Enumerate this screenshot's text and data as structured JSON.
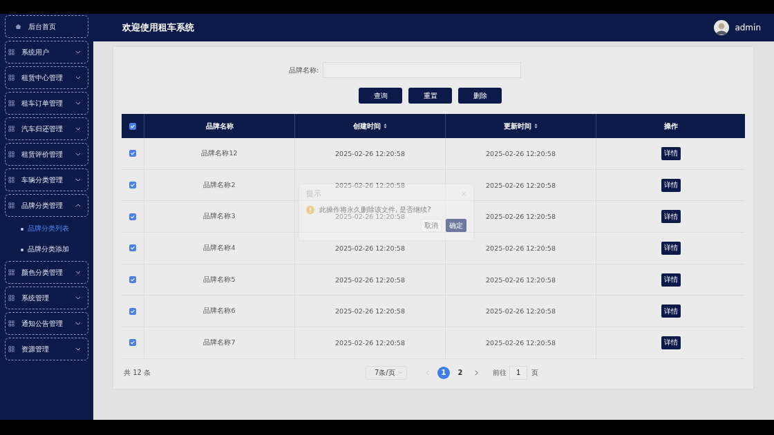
{
  "sidebar": {
    "items": [
      {
        "kind": "home",
        "label": "后台首页"
      },
      {
        "kind": "group",
        "label": "系统用户",
        "expanded": false
      },
      {
        "kind": "group",
        "label": "租赁中心管理",
        "expanded": false
      },
      {
        "kind": "group",
        "label": "租车订单管理",
        "expanded": false
      },
      {
        "kind": "group",
        "label": "汽车归还管理",
        "expanded": false
      },
      {
        "kind": "group",
        "label": "租赁评价管理",
        "expanded": false
      },
      {
        "kind": "group",
        "label": "车辆分类管理",
        "expanded": false
      },
      {
        "kind": "group",
        "label": "品牌分类管理",
        "expanded": true,
        "children": [
          {
            "label": "品牌分类列表",
            "selected": true
          },
          {
            "label": "品牌分类添加",
            "selected": false
          }
        ]
      },
      {
        "kind": "group",
        "label": "颜色分类管理",
        "expanded": false
      },
      {
        "kind": "group",
        "label": "系统管理",
        "expanded": false
      },
      {
        "kind": "group",
        "label": "通知公告管理",
        "expanded": false
      },
      {
        "kind": "group",
        "label": "资源管理",
        "expanded": false
      }
    ]
  },
  "header": {
    "title": "欢迎使用租车系统",
    "user": "admin"
  },
  "search": {
    "label": "品牌名称:",
    "buttons": [
      "查询",
      "重置",
      "删除"
    ]
  },
  "table": {
    "all_checked": true,
    "columns": [
      {
        "label": "品牌名称",
        "sortable": false
      },
      {
        "label": "创建时间",
        "sortable": true
      },
      {
        "label": "更新时间",
        "sortable": true
      },
      {
        "label": "操作",
        "sortable": false
      }
    ],
    "rows": [
      {
        "checked": true,
        "name": "品牌名称12",
        "created": "2025-02-26 12:20:58",
        "updated": "2025-02-26 12:20:58",
        "action": "详情"
      },
      {
        "checked": true,
        "name": "品牌名称2",
        "created": "2025-02-26 12:20:58",
        "updated": "2025-02-26 12:20:58",
        "action": "详情"
      },
      {
        "checked": true,
        "name": "品牌名称3",
        "created": "2025-02-26 12:20:58",
        "updated": "2025-02-26 12:20:58",
        "action": "详情"
      },
      {
        "checked": true,
        "name": "品牌名称4",
        "created": "2025-02-26 12:20:58",
        "updated": "2025-02-26 12:20:58",
        "action": "详情"
      },
      {
        "checked": true,
        "name": "品牌名称5",
        "created": "2025-02-26 12:20:58",
        "updated": "2025-02-26 12:20:58",
        "action": "详情"
      },
      {
        "checked": true,
        "name": "品牌名称6",
        "created": "2025-02-26 12:20:58",
        "updated": "2025-02-26 12:20:58",
        "action": "详情"
      },
      {
        "checked": true,
        "name": "品牌名称7",
        "created": "2025-02-26 12:20:58",
        "updated": "2025-02-26 12:20:58",
        "action": "详情"
      }
    ]
  },
  "pagination": {
    "total": "共 12 条",
    "page_size": "7条/页",
    "pages": [
      {
        "label": "1",
        "selected": true
      },
      {
        "label": "2",
        "selected": false
      }
    ],
    "goto_label": "前往",
    "goto_value": "1",
    "goto_suffix": "页"
  },
  "dialog": {
    "title": "提示",
    "message": "此操作将永久删除该文件, 是否继续?",
    "cancel": "取消",
    "confirm": "确定"
  }
}
